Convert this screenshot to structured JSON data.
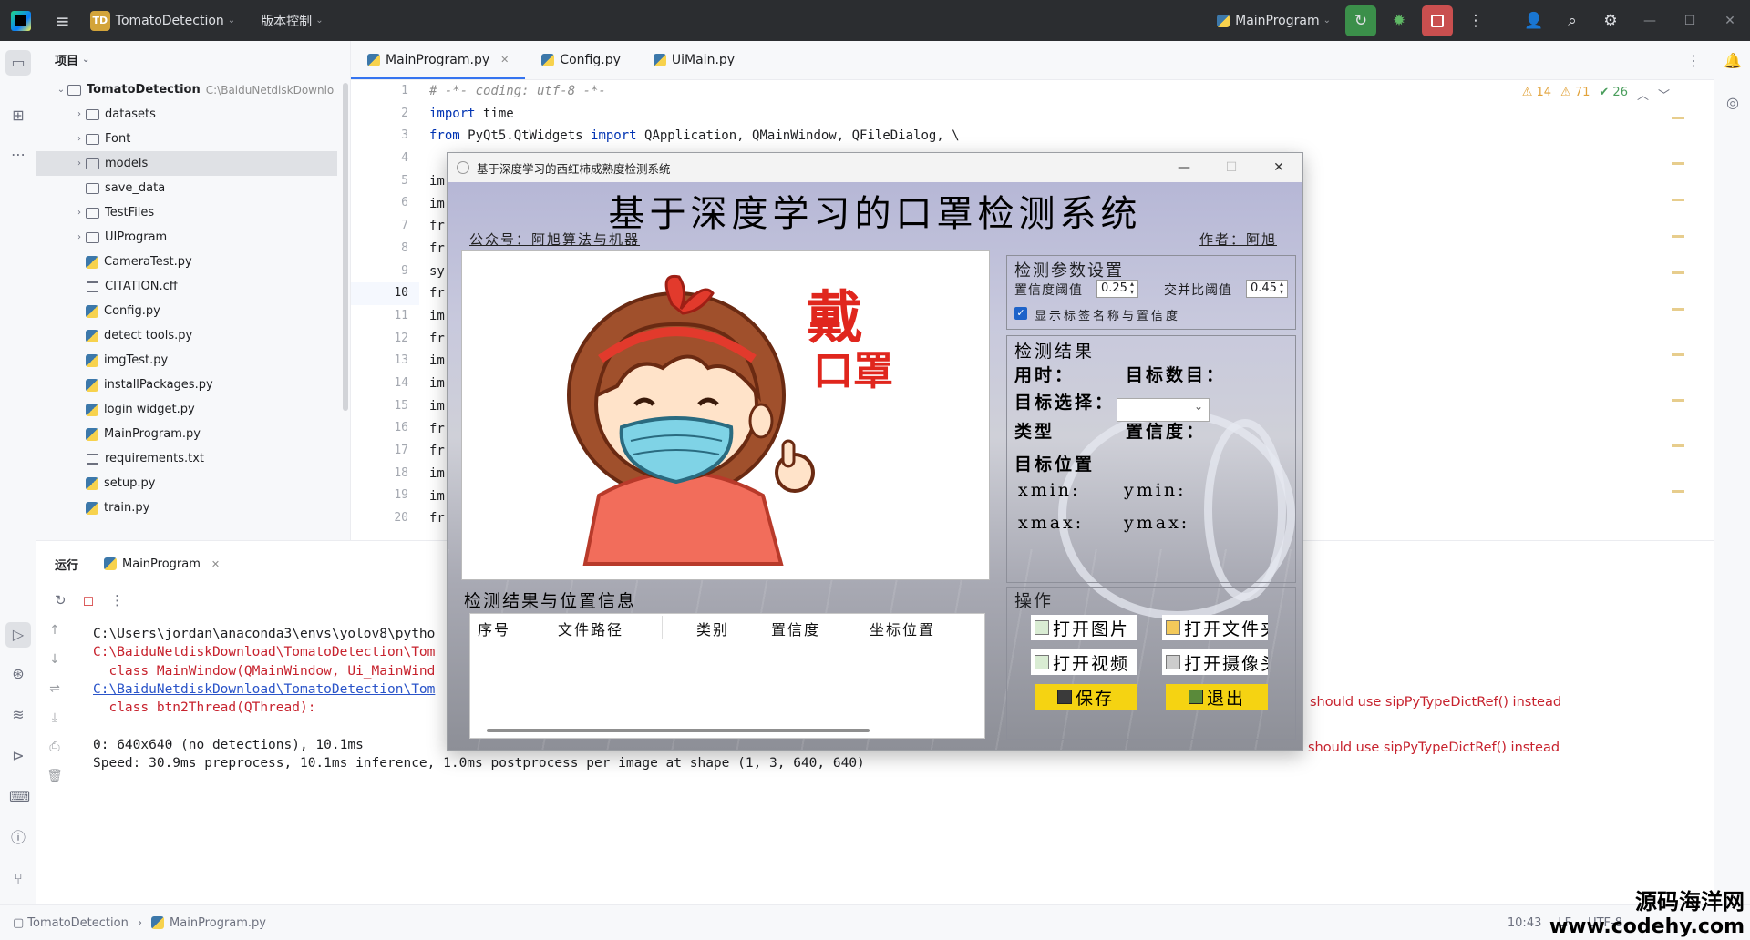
{
  "titlebar": {
    "project_badge": "TD",
    "project_name": "TomatoDetection",
    "vcs_label": "版本控制",
    "run_config": "MainProgram"
  },
  "project_panel": {
    "title": "项目",
    "root": {
      "name": "TomatoDetection",
      "path": "C:\\BaiduNetdiskDownlo"
    },
    "items": [
      {
        "name": "datasets",
        "type": "folder",
        "expandable": true
      },
      {
        "name": "Font",
        "type": "folder",
        "expandable": true
      },
      {
        "name": "models",
        "type": "folder",
        "expandable": true,
        "selected": true
      },
      {
        "name": "save_data",
        "type": "folder",
        "expandable": false
      },
      {
        "name": "TestFiles",
        "type": "folder",
        "expandable": true
      },
      {
        "name": "UIProgram",
        "type": "folder",
        "expandable": true
      },
      {
        "name": "CameraTest.py",
        "type": "py"
      },
      {
        "name": "CITATION.cff",
        "type": "txt"
      },
      {
        "name": "Config.py",
        "type": "py"
      },
      {
        "name": "detect tools.py",
        "type": "py"
      },
      {
        "name": "imgTest.py",
        "type": "py"
      },
      {
        "name": "installPackages.py",
        "type": "py"
      },
      {
        "name": "login widget.py",
        "type": "py"
      },
      {
        "name": "MainProgram.py",
        "type": "py"
      },
      {
        "name": "requirements.txt",
        "type": "txt"
      },
      {
        "name": "setup.py",
        "type": "py"
      },
      {
        "name": "train.py",
        "type": "py"
      }
    ]
  },
  "editor": {
    "tabs": [
      {
        "label": "MainProgram.py",
        "active": true
      },
      {
        "label": "Config.py",
        "active": false
      },
      {
        "label": "UiMain.py",
        "active": false
      }
    ],
    "inspections": {
      "warnings": "14",
      "weak_warnings": "71",
      "ok": "26"
    },
    "line_numbers": [
      "1",
      "2",
      "3",
      "4",
      "5",
      "6",
      "7",
      "8",
      "9",
      "10",
      "11",
      "12",
      "13",
      "14",
      "15",
      "16",
      "17",
      "18",
      "19",
      "20"
    ],
    "current_line": "10",
    "lines": [
      "# -*- coding: utf-8 -*-",
      "import time",
      "from PyQt5.QtWidgets import QApplication, QMainWindow, QFileDialog, \\",
      "",
      "im",
      "im",
      "fr",
      "fr",
      "sy",
      "fr",
      "im",
      "fr",
      "im",
      "im",
      "im",
      "fr",
      "fr",
      "im",
      "im",
      "fr"
    ]
  },
  "run_panel": {
    "label": "运行",
    "tab": "MainProgram",
    "console": [
      {
        "text": "C:\\Users\\jordan\\anaconda3\\envs\\yolov8\\pytho",
        "style": "normal"
      },
      {
        "text": "C:\\BaiduNetdiskDownload\\TomatoDetection\\Tom",
        "style": "err"
      },
      {
        "text": "  class MainWindow(QMainWindow, Ui_MainWind",
        "style": "err"
      },
      {
        "text": "C:\\BaiduNetdiskDownload\\TomatoDetection\\Tom",
        "style": "link"
      },
      {
        "text": "  class btn2Thread(QThread):",
        "style": "err"
      },
      {
        "text": "",
        "style": "normal"
      },
      {
        "text": "0: 640x640 (no detections), 10.1ms",
        "style": "normal"
      },
      {
        "text": "Speed: 30.9ms preprocess, 10.1ms inference, 1.0ms postprocess per image at shape (1, 3, 640, 640)",
        "style": "normal"
      }
    ],
    "warning_tail_1": "should use sipPyTypeDictRef() instead",
    "warning_tail_2": "should use sipPyTypeDictRef() instead"
  },
  "statusbar": {
    "crumb_project": "TomatoDetection",
    "crumb_file": "MainProgram.py",
    "position": "10:43",
    "line_sep": "LF",
    "encoding": "UTF-8"
  },
  "watermark": {
    "line1": "源码海洋网",
    "line2": "www.codehy.com"
  },
  "app_window": {
    "title": "基于深度学习的西红柿成熟度检测系统",
    "heading": "基于深度学习的口罩检测系统",
    "wechat": "公众号：阿旭算法与机器",
    "author": "作者：阿旭",
    "image_text_1": "戴",
    "image_text_2": "口罩",
    "params_title": "检测参数设置",
    "conf_label": "置信度阈值",
    "conf_value": "0.25",
    "iou_label": "交并比阈值",
    "iou_value": "0.45",
    "show_labels_label": "显示标签名称与置信度",
    "results_title": "检测结果",
    "time_label": "用时：",
    "count_label": "目标数目：",
    "target_select_label": "目标选择：",
    "type_label": "类型",
    "confidence_label": "置信度：",
    "position_label": "目标位置",
    "xmin_label": "xmin:",
    "ymin_label": "ymin:",
    "xmax_label": "xmax:",
    "ymax_label": "ymax:",
    "table_title": "检测结果与位置信息",
    "table_headers": [
      "序号",
      "文件路径",
      "类别",
      "置信度",
      "坐标位置"
    ],
    "ops_title": "操作",
    "btn_open_image": "打开图片",
    "btn_open_folder": "打开文件夹",
    "btn_open_video": "打开视频",
    "btn_open_camera": "打开摄像头",
    "btn_save": "保存",
    "btn_exit": "退出"
  }
}
